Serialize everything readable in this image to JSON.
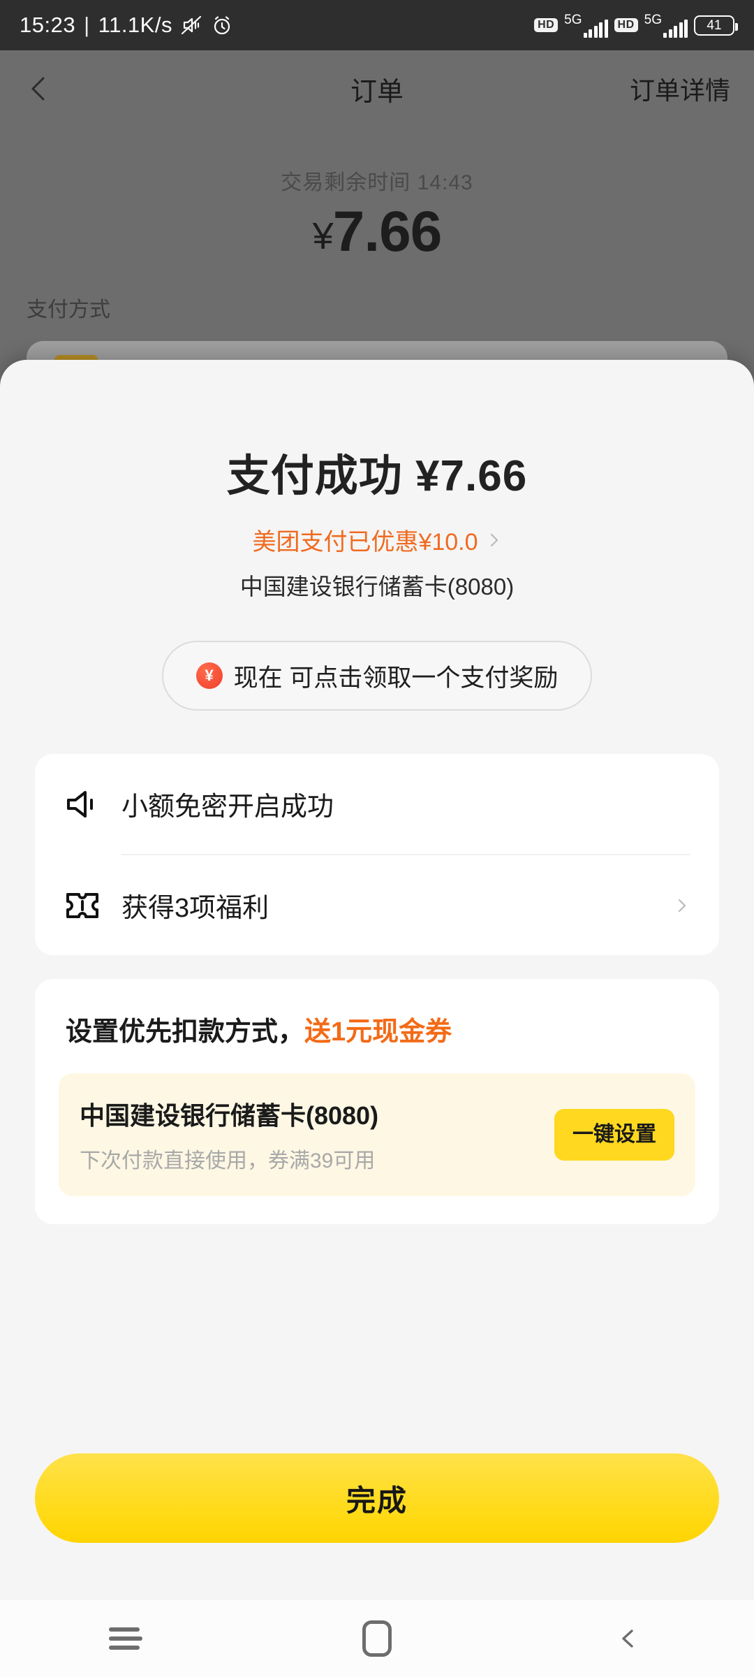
{
  "statusbar": {
    "time": "15:23",
    "separator": "|",
    "network_speed": "11.1K/s",
    "mute_icon": "mute-icon",
    "alarm_icon": "alarm-icon",
    "hd_badge_1": "HD",
    "network_1": "5G",
    "hd_badge_2": "HD",
    "network_2": "5G",
    "battery_level": "41"
  },
  "header": {
    "back_icon": "back-chevron-icon",
    "title": "订单",
    "action_label": "订单详情"
  },
  "background_page": {
    "timer_label": "交易剩余时间 14:43",
    "amount_symbol": "¥",
    "amount_value": "7.66",
    "pay_method_label": "支付方式"
  },
  "sheet": {
    "success_title": "支付成功 ¥7.66",
    "discount_text": "美团支付已优惠¥10.0",
    "discount_chevron": "chevron-right-icon",
    "card_line": "中国建设银行储蓄卡(8080)",
    "reward_pill": {
      "coin_icon": "yen-coin-icon",
      "coin_symbol": "¥",
      "text": "现在 可点击领取一个支付奖励"
    },
    "benefits_card": {
      "rows": [
        {
          "icon": "megaphone-icon",
          "label": "小额免密开启成功",
          "has_chevron": false
        },
        {
          "icon": "ticket-icon",
          "label": "获得3项福利",
          "has_chevron": true
        }
      ]
    },
    "priority_card": {
      "title_main": "设置优先扣款方式，",
      "title_highlight": "送1元现金券",
      "bank_name": "中国建设银行储蓄卡(8080)",
      "bank_sub": "下次付款直接使用，券满39可用",
      "set_button_label": "一键设置"
    },
    "done_button_label": "完成"
  },
  "navbar": {
    "recents_icon": "recents-icon",
    "home_icon": "home-icon",
    "back_icon": "nav-back-icon"
  },
  "colors": {
    "brand_yellow": "#FFD81F",
    "accent_orange": "#F36A16",
    "coin_red": "#F0402A",
    "sheet_bg": "#F5F5F5",
    "inner_card_bg": "#FDF7E4"
  }
}
